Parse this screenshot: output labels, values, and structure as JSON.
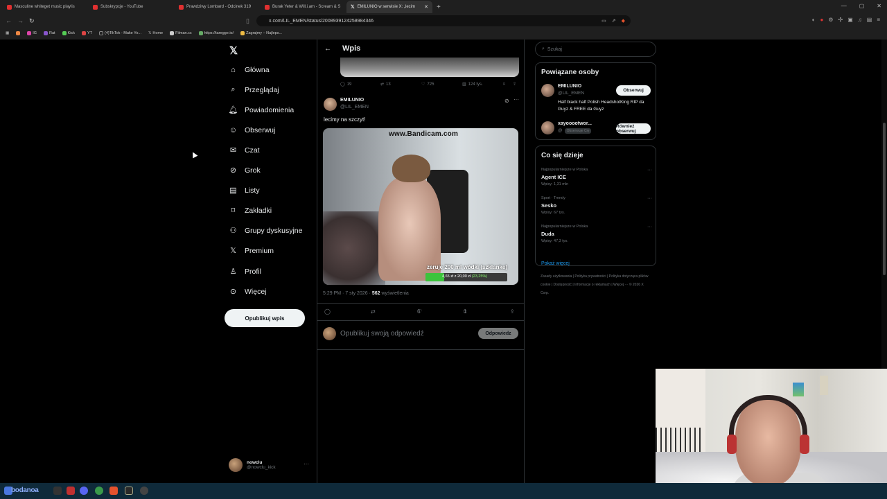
{
  "browser": {
    "tabs": [
      {
        "label": "Masculine whiteget music playlis"
      },
      {
        "label": "Subskrypcje - YouTube"
      },
      {
        "label": "Prawdziwy Lombard - Odcinek 319"
      },
      {
        "label": "Burak Yeter & Will.i.am - Scream & S"
      },
      {
        "label": "EMILUNIO w serwisie X: „lecim"
      }
    ],
    "new_tab": "+",
    "url": "x.com/LIL_EMEN/status/2008939124258984346",
    "bookmarks": [
      "IG",
      "Rat",
      "Kick",
      "YT",
      "(4)TikTok - Make Yo...",
      "Home",
      "Filman.cc",
      "https://taregge.io/",
      "Zagrajmy – Najleps..."
    ]
  },
  "nav": {
    "items": [
      {
        "label": "Główna",
        "icon": "home-icon"
      },
      {
        "label": "Przeglądaj",
        "icon": "search-icon"
      },
      {
        "label": "Powiadomienia",
        "icon": "bell-icon"
      },
      {
        "label": "Obserwuj",
        "icon": "person-add-icon"
      },
      {
        "label": "Czat",
        "icon": "mail-icon"
      },
      {
        "label": "Grok",
        "icon": "grok-icon"
      },
      {
        "label": "Listy",
        "icon": "list-icon"
      },
      {
        "label": "Zakładki",
        "icon": "bookmark-icon"
      },
      {
        "label": "Grupy dyskusyjne",
        "icon": "community-icon"
      },
      {
        "label": "Premium",
        "icon": "x-logo-icon"
      },
      {
        "label": "Profil",
        "icon": "person-icon"
      },
      {
        "label": "Więcej",
        "icon": "more-circle-icon"
      }
    ],
    "post_button": "Opublikuj wpis",
    "account": {
      "name": "nowclu",
      "handle": "@nowclu_kick",
      "more": "···"
    }
  },
  "main": {
    "header": "Wpis",
    "prev_post_actions": {
      "replies": "19",
      "reposts": "13",
      "likes": "725",
      "views": "124 tys."
    },
    "tweet": {
      "name": "EMILUNIO",
      "handle": "@LIL_EMEN",
      "text": "lecimy na szczyt!",
      "media": {
        "watermark": "www.Bandicam.com",
        "caption": "zeruje 200 ml wódki (szklanke)",
        "progress_text": "4,65 zł z 20,00 zł",
        "progress_pct_label": "(23,25%)",
        "progress_fraction": 0.2325
      },
      "time": "5:29 PM · 7 sty 2026 ·",
      "views": "562",
      "views_label": "wyświetlenia",
      "likes": "6",
      "bookmarks": "1"
    },
    "reply": {
      "placeholder": "Opublikuj swoją odpowiedź",
      "button": "Odpowiedz"
    }
  },
  "right": {
    "search_placeholder": "Szukaj",
    "related": {
      "title": "Powiązane osoby",
      "people": [
        {
          "name": "EMILUNIO",
          "handle": "@LIL_EMEN",
          "bio": "Half black half Polish HeadshotKing RIP da Guyz & FREE da Guyz",
          "button": "Obserwuj"
        },
        {
          "name": "xayooootwor...",
          "handle": "@",
          "tag": "Obserwuje Cię",
          "button": "Również obserwuj"
        }
      ]
    },
    "trends": {
      "title": "Co się dzieje",
      "items": [
        {
          "context": "Najpopularniejsze w Polska",
          "name": "Agent ICE",
          "count": "Wpisy: 1,31 mln"
        },
        {
          "context": "Sport · Trendy",
          "name": "Sesko",
          "count": "Wpisy: 67 tys."
        },
        {
          "context": "Najpopularniejsze w Polska",
          "name": "Duda",
          "count": "Wpisy: 47,3 tys."
        }
      ],
      "show_more": "Pokaż więcej"
    },
    "footer": "Zasady użytkowania | Polityka prywatności | Polityka dotycząca plików cookie | Dostępność | Informacje o reklamach | Więcej ··· © 2026 X Corp."
  },
  "taskbar": {
    "label": "bodanoa"
  }
}
